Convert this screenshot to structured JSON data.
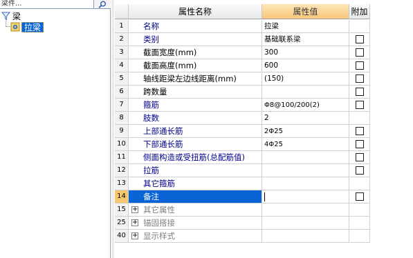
{
  "tree": {
    "search_value": "梁件...",
    "root_label": "梁",
    "child_label": "拉梁"
  },
  "grid": {
    "headers": {
      "name": "属性名称",
      "value": "属性值",
      "extra": "附加"
    },
    "rows": [
      {
        "num": "1",
        "name": "名称",
        "value": "拉梁",
        "checkbox": false,
        "blue": true
      },
      {
        "num": "2",
        "name": "类别",
        "value": "基础联系梁",
        "checkbox": true,
        "blue": true
      },
      {
        "num": "3",
        "name": "截面宽度(mm)",
        "value": "300",
        "checkbox": true,
        "blue": false
      },
      {
        "num": "4",
        "name": "截面高度(mm)",
        "value": "600",
        "checkbox": true,
        "blue": false
      },
      {
        "num": "5",
        "name": "轴线距梁左边线距离(mm)",
        "value": "(150)",
        "checkbox": true,
        "blue": false
      },
      {
        "num": "6",
        "name": "跨数量",
        "value": "",
        "checkbox": true,
        "blue": false
      },
      {
        "num": "7",
        "name": "箍筋",
        "value": "Φ8@100/200(2)",
        "checkbox": true,
        "blue": true
      },
      {
        "num": "8",
        "name": "肢数",
        "value": "2",
        "checkbox": false,
        "blue": true
      },
      {
        "num": "9",
        "name": "上部通长筋",
        "value": "2Φ25",
        "checkbox": true,
        "blue": true
      },
      {
        "num": "10",
        "name": "下部通长筋",
        "value": "4Φ25",
        "checkbox": true,
        "blue": true
      },
      {
        "num": "11",
        "name": "侧面构造或受扭筋(总配筋值)",
        "value": "",
        "checkbox": true,
        "blue": true
      },
      {
        "num": "12",
        "name": "拉筋",
        "value": "",
        "checkbox": true,
        "blue": true
      },
      {
        "num": "13",
        "name": "其它箍筋",
        "value": "",
        "checkbox": false,
        "blue": true
      },
      {
        "num": "14",
        "name": "备注",
        "value": "",
        "checkbox": true,
        "blue": false,
        "selected": true
      }
    ],
    "groups": [
      {
        "num": "15",
        "name": "其它属性"
      },
      {
        "num": "25",
        "name": "锚固搭接"
      },
      {
        "num": "40",
        "name": "显示样式"
      }
    ]
  },
  "colors": {
    "selection": "#0a64d6",
    "header_value_bg": "#f8c77c",
    "blue_text": "#00008b"
  }
}
